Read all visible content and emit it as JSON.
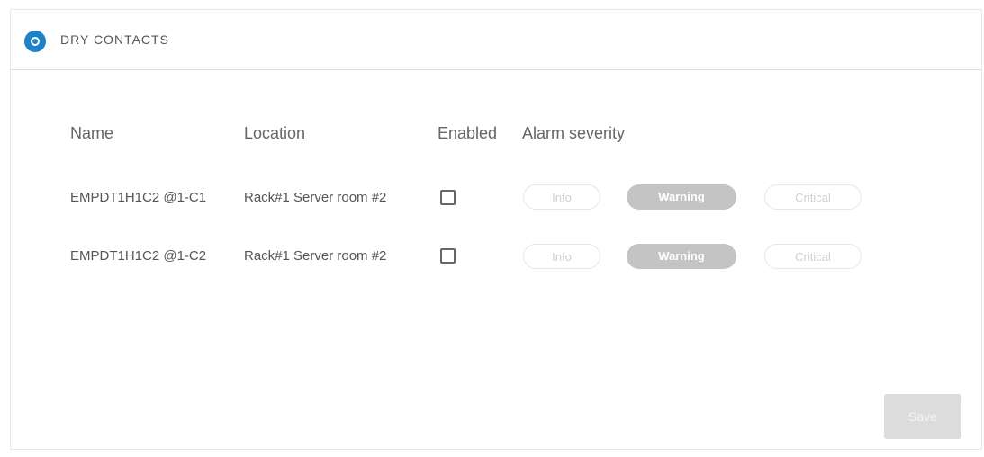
{
  "panel": {
    "title": "DRY CONTACTS"
  },
  "table": {
    "headers": {
      "name": "Name",
      "location": "Location",
      "enabled": "Enabled",
      "severity": "Alarm severity"
    },
    "rows": [
      {
        "name": "EMPDT1H1C2 @1-C1",
        "location": "Rack#1 Server room #2",
        "enabled": false,
        "severity_options": [
          "Info",
          "Warning",
          "Critical"
        ],
        "selected_severity": "Warning"
      },
      {
        "name": "EMPDT1H1C2 @1-C2",
        "location": "Rack#1 Server room #2",
        "enabled": false,
        "severity_options": [
          "Info",
          "Warning",
          "Critical"
        ],
        "selected_severity": "Warning"
      }
    ]
  },
  "actions": {
    "save_label": "Save"
  },
  "colors": {
    "accent": "#1e82c8",
    "disabled_bg": "#c4c4c4",
    "save_disabled_bg": "#dcdcdc"
  }
}
